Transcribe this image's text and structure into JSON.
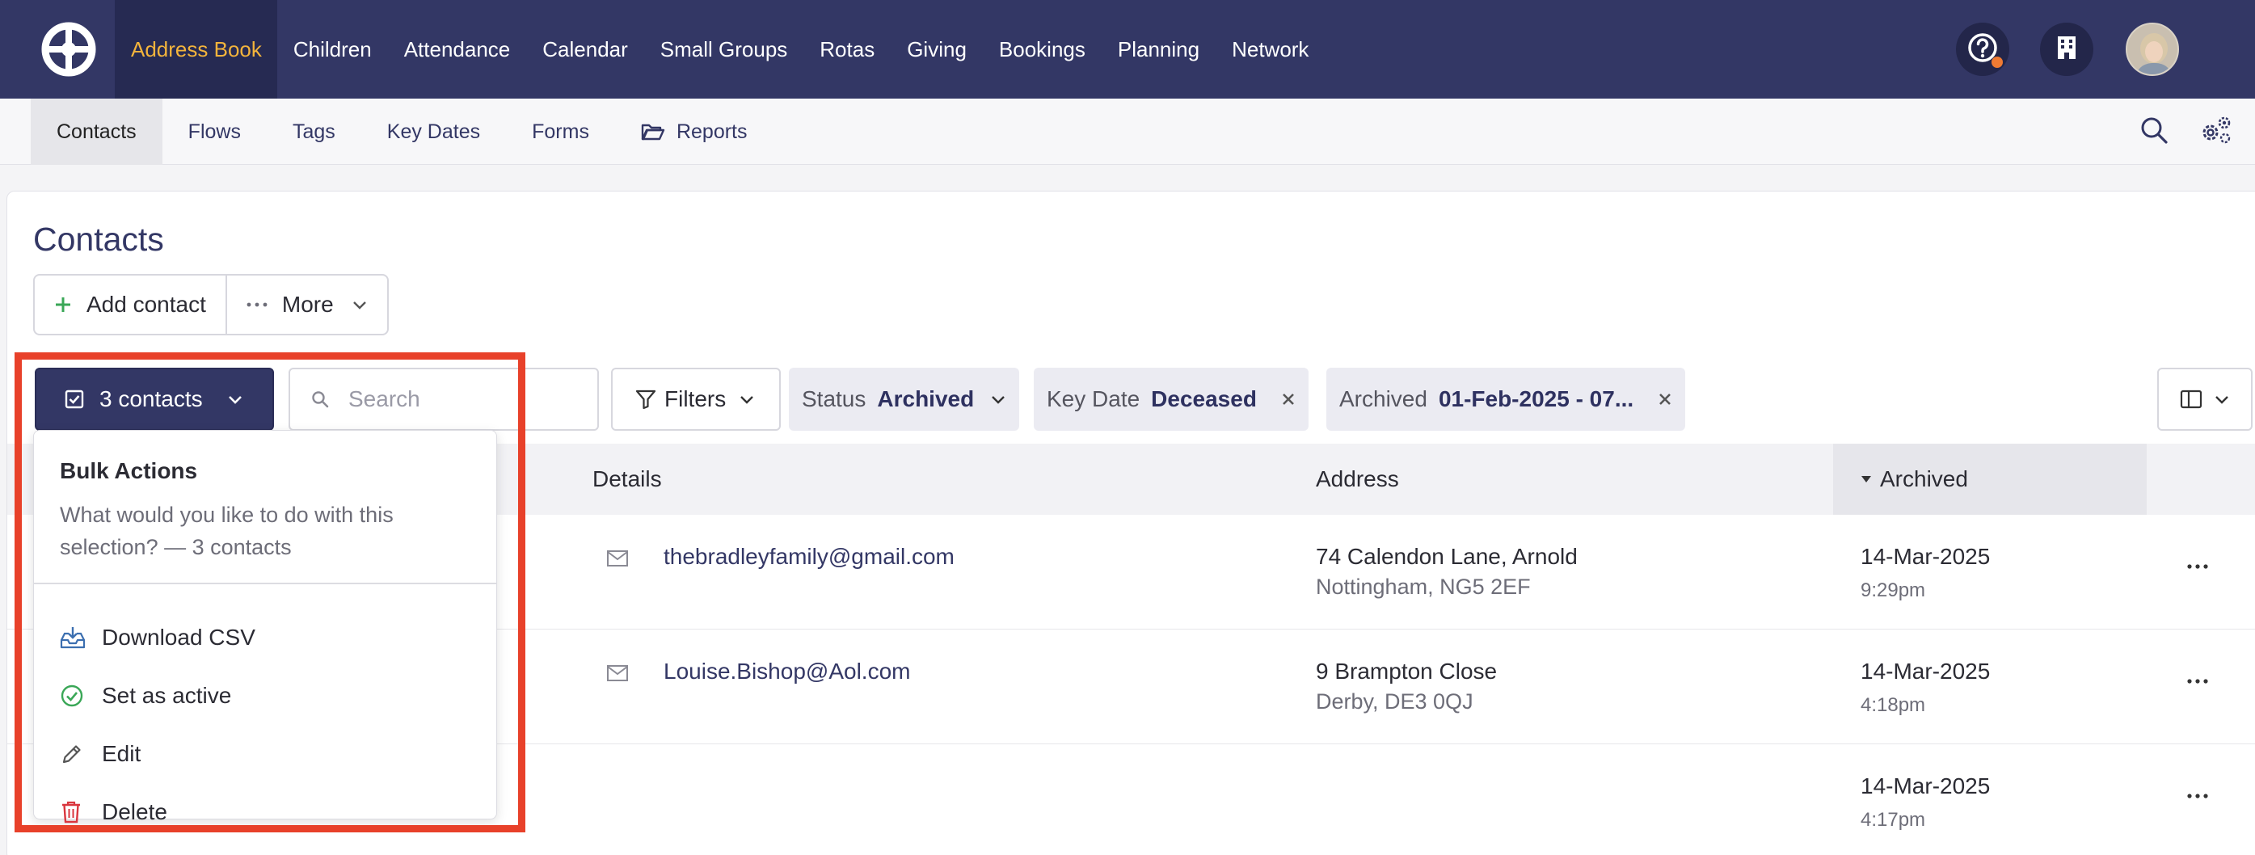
{
  "topnav": {
    "items": [
      {
        "label": "Address Book",
        "active": true
      },
      {
        "label": "Children"
      },
      {
        "label": "Attendance"
      },
      {
        "label": "Calendar"
      },
      {
        "label": "Small Groups"
      },
      {
        "label": "Rotas"
      },
      {
        "label": "Giving"
      },
      {
        "label": "Bookings"
      },
      {
        "label": "Planning"
      },
      {
        "label": "Network"
      }
    ],
    "icons": [
      "help-icon",
      "building-icon",
      "avatar"
    ],
    "colors": {
      "bar": "#333765",
      "active_bg": "#262a52",
      "active_text": "#f3b43c",
      "notification": "#ef7a33"
    }
  },
  "subnav": {
    "items": [
      {
        "label": "Contacts",
        "active": true
      },
      {
        "label": "Flows"
      },
      {
        "label": "Tags"
      },
      {
        "label": "Key Dates"
      },
      {
        "label": "Forms"
      },
      {
        "label": "Reports",
        "icon": "folder-open-icon"
      }
    ]
  },
  "page": {
    "title": "Contacts",
    "add_contact": "Add contact",
    "more": "More"
  },
  "toolbar": {
    "selection_label": "3 contacts",
    "search_placeholder": "Search",
    "filters_label": "Filters",
    "chips": [
      {
        "key": "Status",
        "value": "Archived"
      },
      {
        "key": "Key Date",
        "value": "Deceased"
      },
      {
        "key": "Archived",
        "value": "01-Feb-2025 - 07..."
      }
    ]
  },
  "table": {
    "columns": [
      "Details",
      "Address",
      "Archived"
    ],
    "sorted_column": "Archived",
    "rows": [
      {
        "email": "thebradleyfamily@gmail.com",
        "address1": "74 Calendon Lane, Arnold",
        "address2": "Nottingham, NG5 2EF",
        "date": "14-Mar-2025",
        "time": "9:29pm"
      },
      {
        "email": "Louise.Bishop@Aol.com",
        "address1": "9 Brampton Close",
        "address2": "Derby, DE3 0QJ",
        "date": "14-Mar-2025",
        "time": "4:18pm"
      },
      {
        "email": "",
        "address1": "",
        "address2": "",
        "date": "14-Mar-2025",
        "time": "4:17pm"
      }
    ]
  },
  "bulk": {
    "title": "Bulk Actions",
    "description": "What would you like to do with this selection? — 3 contacts",
    "actions": [
      {
        "label": "Download CSV",
        "icon": "download-tray-icon"
      },
      {
        "label": "Set as active",
        "icon": "check-circle-icon"
      },
      {
        "label": "Edit",
        "icon": "pencil-icon"
      },
      {
        "label": "Delete",
        "icon": "trash-icon"
      }
    ]
  },
  "accent": {
    "highlight": "#e8412a",
    "link": "#333765",
    "success": "#3aa757",
    "danger": "#d9363e"
  }
}
